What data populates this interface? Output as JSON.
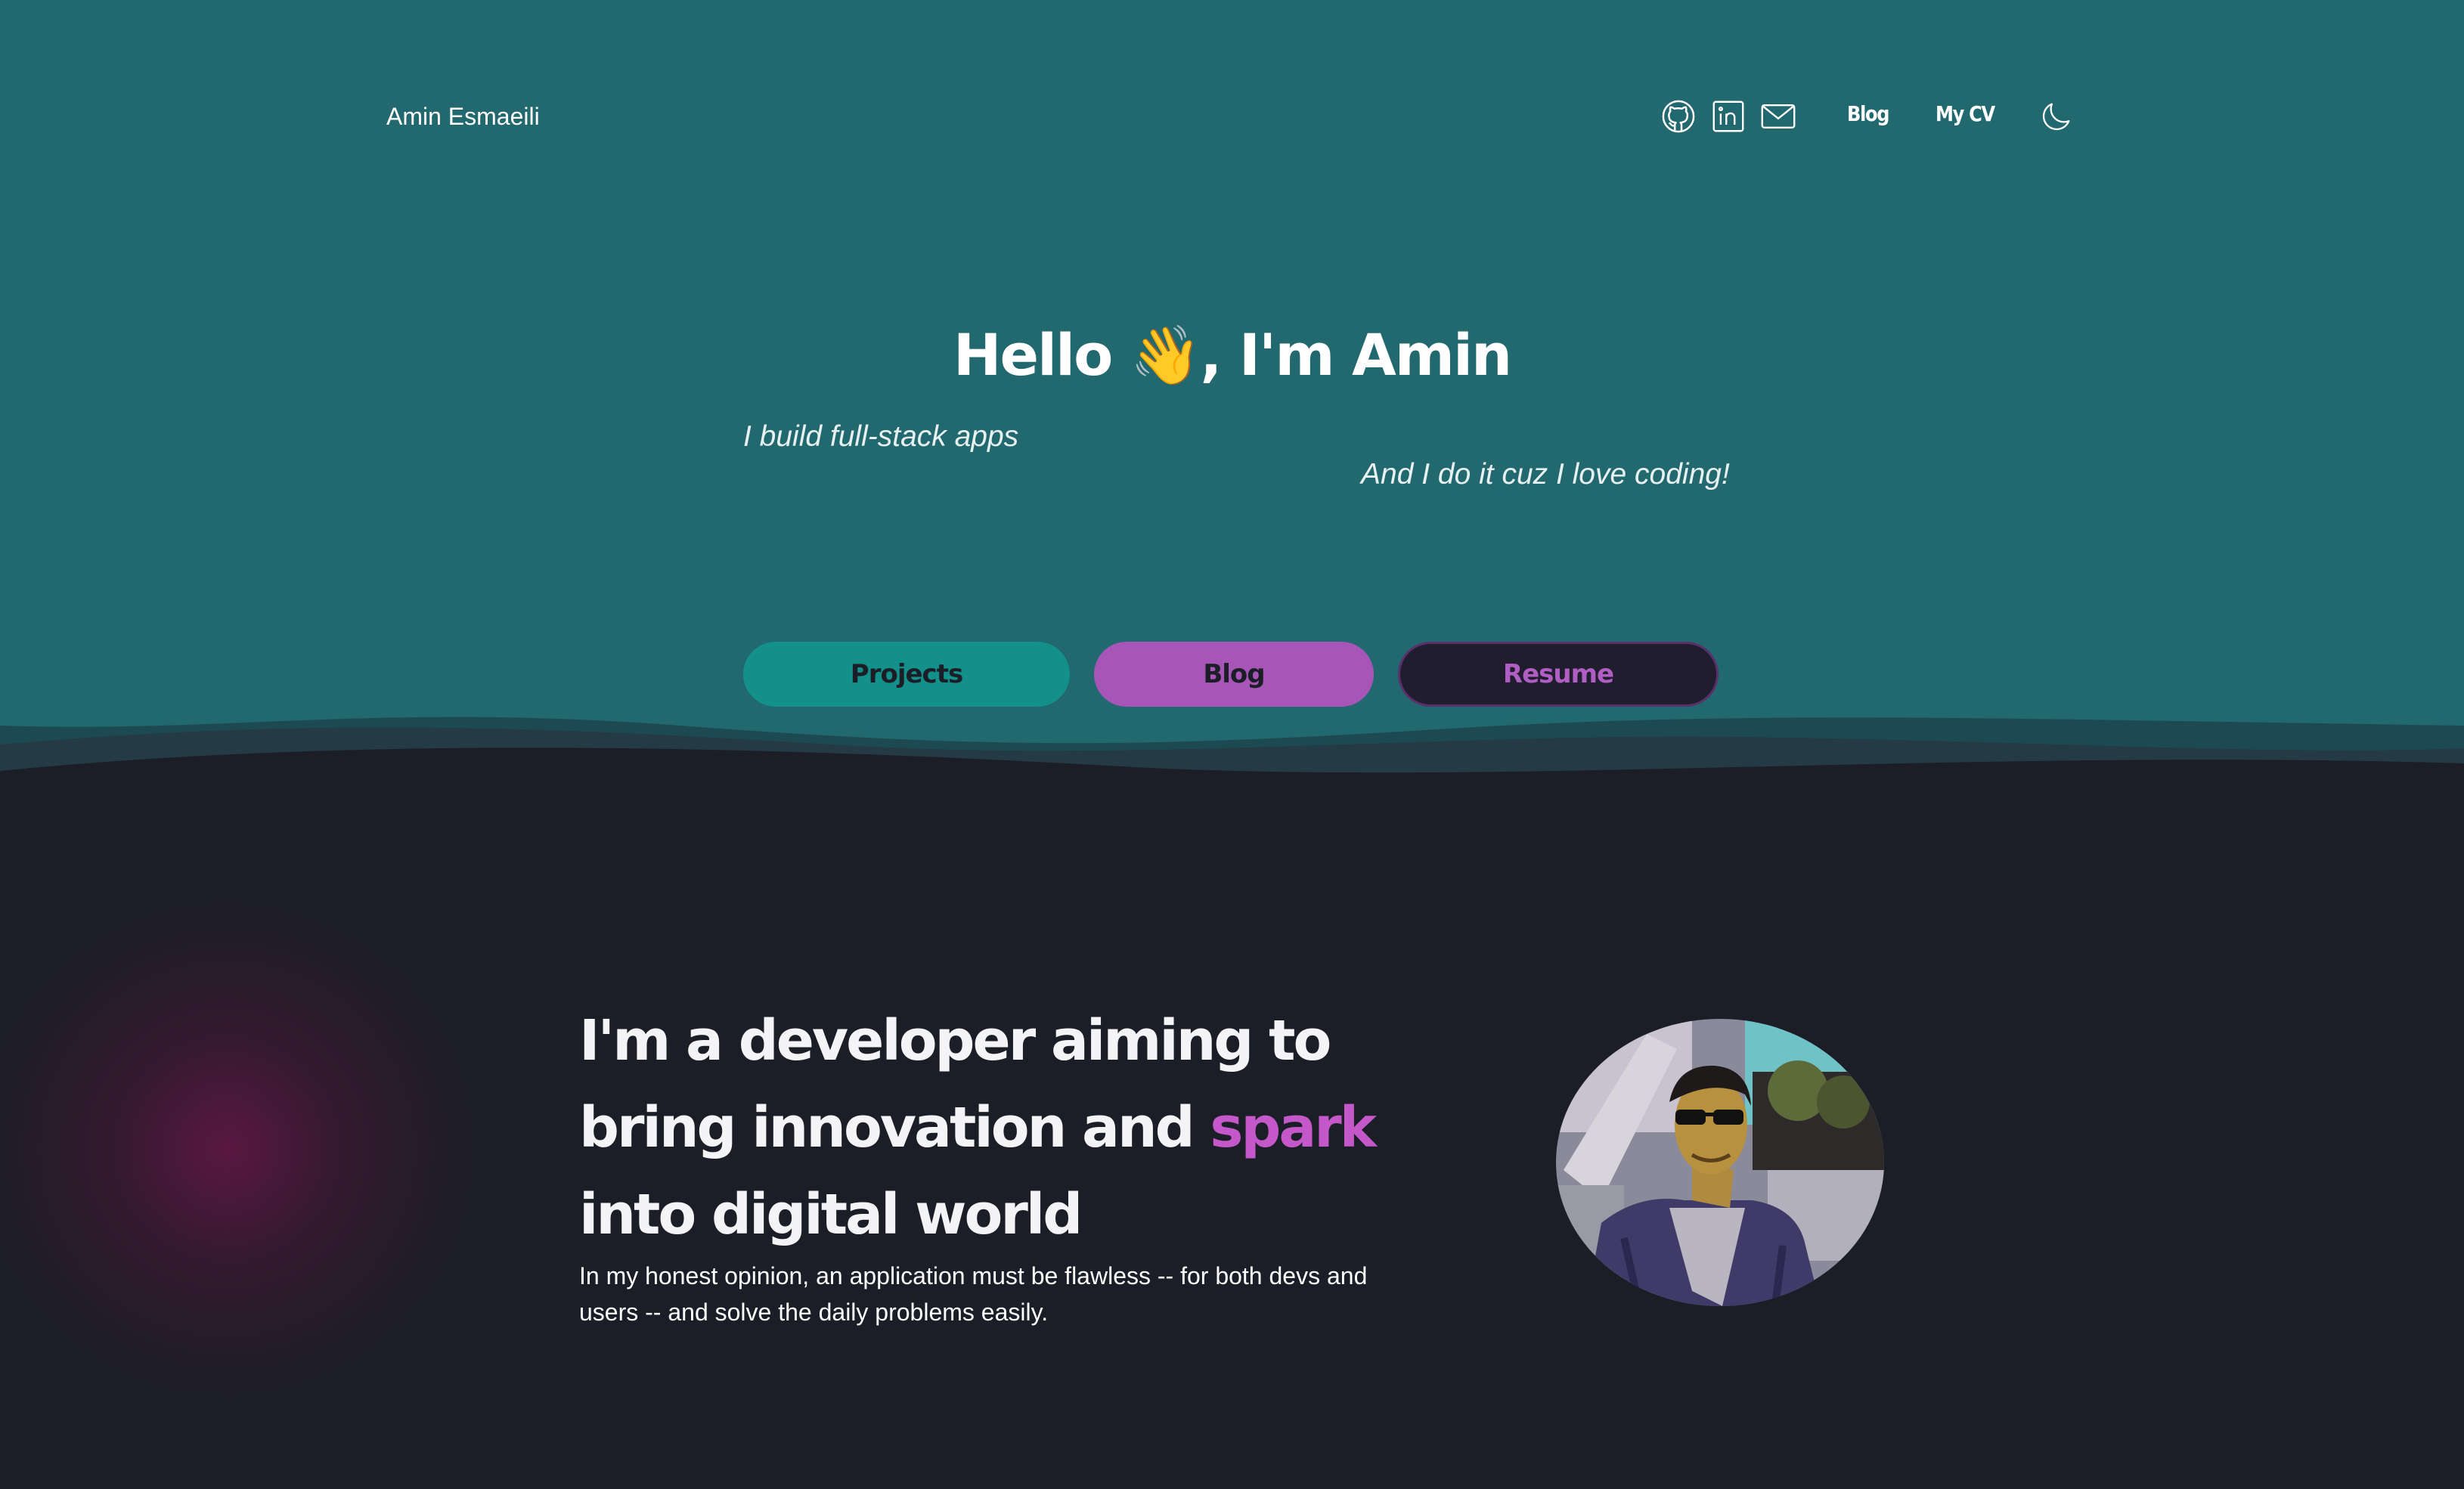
{
  "header": {
    "brand": "Amin Esmaeili",
    "icons": [
      "github-icon",
      "linkedin-icon",
      "mail-icon"
    ],
    "links": {
      "blog": "Blog",
      "cv": "My CV"
    },
    "theme_icon": "moon-icon"
  },
  "hero": {
    "greeting_before": "Hello ",
    "emoji": "👋",
    "greeting_after": ", I'm Amin",
    "tagline_1": "I build full-stack apps",
    "tagline_2": "And I do it cuz I love coding!",
    "buttons": {
      "projects": "Projects",
      "blog": "Blog",
      "resume": "Resume"
    }
  },
  "about": {
    "headline_before": "I'm a developer aiming to bring innovation and ",
    "headline_highlight": "spark",
    "headline_after": " into digital world",
    "blurb": "In my honest opinion, an application must be flawless -- for both devs and users -- and solve the daily problems easily."
  },
  "colors": {
    "hero_bg": "#21686f",
    "page_bg": "#1c1e27",
    "projects_btn": "#14908a",
    "blog_btn": "#a756b8",
    "accent": "#c458c9"
  }
}
